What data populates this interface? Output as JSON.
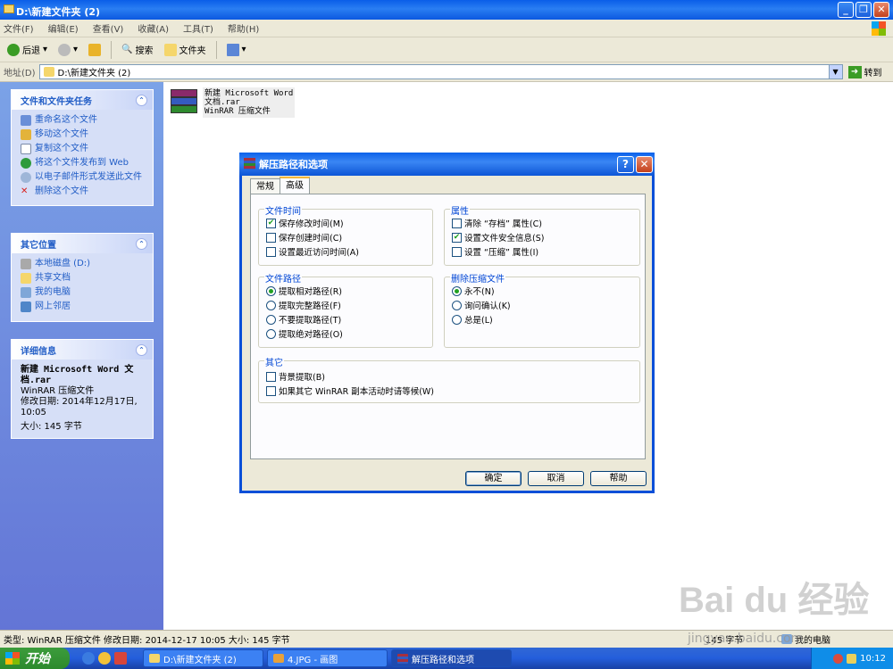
{
  "window": {
    "title": "D:\\新建文件夹 (2)",
    "min": "_",
    "max": "❐",
    "close": "✕"
  },
  "menu": [
    "文件(F)",
    "编辑(E)",
    "查看(V)",
    "收藏(A)",
    "工具(T)",
    "帮助(H)"
  ],
  "toolbar": {
    "back": "后退",
    "search": "搜索",
    "folders": "文件夹"
  },
  "address": {
    "label": "地址(D)",
    "value": "D:\\新建文件夹 (2)",
    "go": "转到"
  },
  "tasks": {
    "title": "文件和文件夹任务",
    "items": [
      "重命名这个文件",
      "移动这个文件",
      "复制这个文件",
      "将这个文件发布到 Web",
      "以电子邮件形式发送此文件",
      "删除这个文件"
    ]
  },
  "places": {
    "title": "其它位置",
    "items": [
      "本地磁盘 (D:)",
      "共享文档",
      "我的电脑",
      "网上邻居"
    ]
  },
  "details": {
    "title": "详细信息",
    "name": "新建 Microsoft Word 文档.rar",
    "type": "WinRAR 压缩文件",
    "modified": "修改日期: 2014年12月17日, 10:05",
    "size": "大小: 145 字节"
  },
  "file": {
    "line1": "新建 Microsoft Word",
    "line2": "文档.rar",
    "line3": "WinRAR 压缩文件"
  },
  "dialog": {
    "title": "解压路径和选项",
    "help": "?",
    "close": "✕",
    "tabs": [
      "常规",
      "高级"
    ],
    "group_time": {
      "label": "文件时间",
      "items": [
        {
          "text": "保存修改时间(M)",
          "checked": true
        },
        {
          "text": "保存创建时间(C)",
          "checked": false
        },
        {
          "text": "设置最近访问时间(A)",
          "checked": false
        }
      ]
    },
    "group_attr": {
      "label": "属性",
      "items": [
        {
          "text": "清除 “存档” 属性(C)",
          "checked": false
        },
        {
          "text": "设置文件安全信息(S)",
          "checked": true
        },
        {
          "text": "设置 “压缩” 属性(I)",
          "checked": false
        }
      ]
    },
    "group_path": {
      "label": "文件路径",
      "items": [
        {
          "text": "提取相对路径(R)",
          "selected": true
        },
        {
          "text": "提取完整路径(F)",
          "selected": false
        },
        {
          "text": "不要提取路径(T)",
          "selected": false
        },
        {
          "text": "提取绝对路径(O)",
          "selected": false
        }
      ]
    },
    "group_delete": {
      "label": "删除压缩文件",
      "items": [
        {
          "text": "永不(N)",
          "selected": true
        },
        {
          "text": "询问确认(K)",
          "selected": false
        },
        {
          "text": "总是(L)",
          "selected": false
        }
      ]
    },
    "group_other": {
      "label": "其它",
      "items": [
        {
          "text": "背景提取(B)",
          "checked": false
        },
        {
          "text": "如果其它 WinRAR 副本活动时请等候(W)",
          "checked": false
        }
      ]
    },
    "buttons": {
      "ok": "确定",
      "cancel": "取消",
      "help": "帮助"
    }
  },
  "status": {
    "info": "类型: WinRAR 压缩文件 修改日期: 2014-12-17 10:05 大小: 145 字节",
    "size": "145 字节",
    "computer": "我的电脑"
  },
  "taskbar": {
    "start": "开始",
    "tasks": [
      "D:\\新建文件夹 (2)",
      "4.JPG - 画图",
      "解压路径和选项"
    ],
    "clock": "10:12"
  },
  "watermark": {
    "logo": "Bai du 经验",
    "url": "jingyan.baidu.com"
  }
}
